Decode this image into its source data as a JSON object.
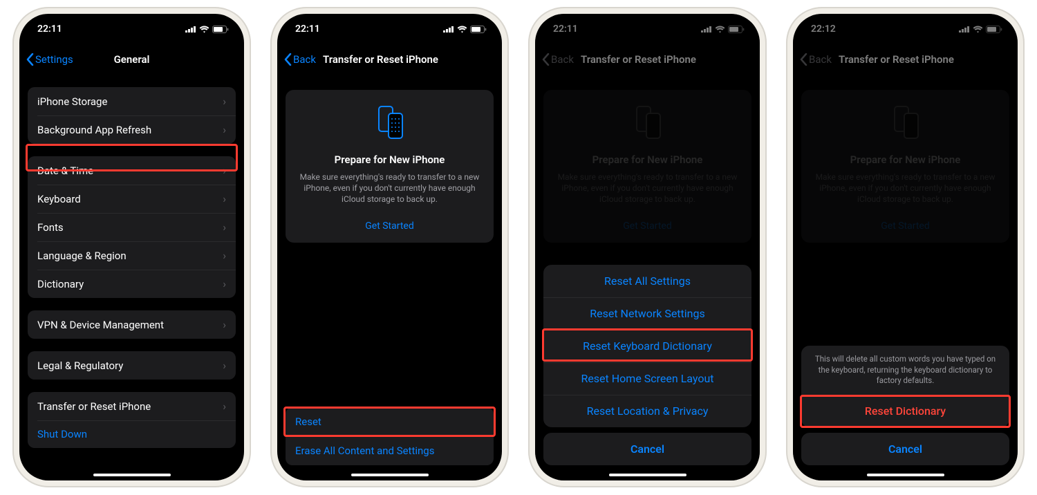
{
  "status_time_a": "22:11",
  "status_time_b": "22:12",
  "screen1": {
    "back": "Settings",
    "title": "General",
    "group1": [
      "iPhone Storage",
      "Background App Refresh"
    ],
    "group2": [
      "Date & Time",
      "Keyboard",
      "Fonts",
      "Language & Region",
      "Dictionary"
    ],
    "group3": [
      "VPN & Device Management"
    ],
    "group4": [
      "Legal & Regulatory"
    ],
    "group5_row1": "Transfer or Reset iPhone",
    "group5_row2": "Shut Down"
  },
  "screen2": {
    "back": "Back",
    "title": "Transfer or Reset iPhone",
    "card_title": "Prepare for New iPhone",
    "card_desc": "Make sure everything's ready to transfer to a new iPhone, even if you don't currently have enough iCloud storage to back up.",
    "card_link": "Get Started",
    "row_reset": "Reset",
    "row_erase": "Erase All Content and Settings"
  },
  "screen3": {
    "options": [
      "Reset All Settings",
      "Reset Network Settings",
      "Reset Keyboard Dictionary",
      "Reset Home Screen Layout",
      "Reset Location & Privacy"
    ],
    "cancel": "Cancel"
  },
  "screen4": {
    "msg": "This will delete all custom words you have typed on the keyboard, returning the keyboard dictionary to factory defaults.",
    "action": "Reset Dictionary",
    "cancel": "Cancel"
  }
}
